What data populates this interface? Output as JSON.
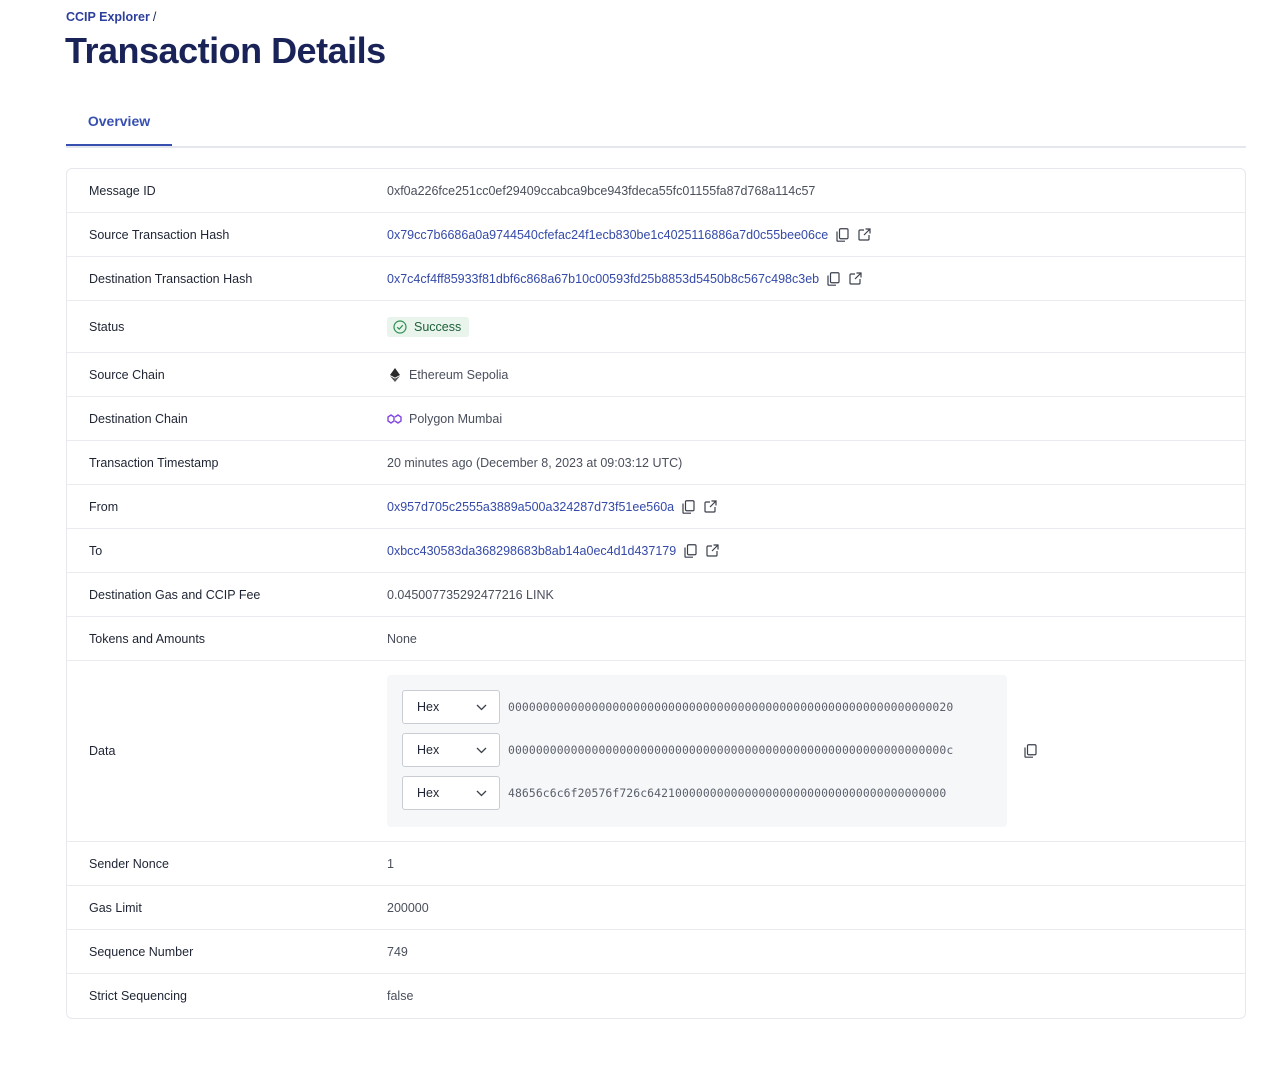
{
  "breadcrumb": {
    "root": "CCIP Explorer",
    "separator": "/"
  },
  "page": {
    "title": "Transaction Details"
  },
  "tabs": [
    {
      "label": "Overview",
      "active": true
    }
  ],
  "details": {
    "message_id": {
      "label": "Message ID",
      "value": "0xf0a226fce251cc0ef29409ccabca9bce943fdeca55fc01155fa87d768a114c57"
    },
    "source_tx_hash": {
      "label": "Source Transaction Hash",
      "value": "0x79cc7b6686a0a9744540cfefac24f1ecb830be1c4025116886a7d0c55bee06ce"
    },
    "dest_tx_hash": {
      "label": "Destination Transaction Hash",
      "value": "0x7c4cf4ff85933f81dbf6c868a67b10c00593fd25b8853d5450b8c567c498c3eb"
    },
    "status": {
      "label": "Status",
      "value": "Success"
    },
    "source_chain": {
      "label": "Source Chain",
      "value": "Ethereum Sepolia",
      "icon": "ethereum-icon"
    },
    "dest_chain": {
      "label": "Destination Chain",
      "value": "Polygon Mumbai",
      "icon": "polygon-icon"
    },
    "timestamp": {
      "label": "Transaction Timestamp",
      "value": "20 minutes ago (December 8, 2023 at 09:03:12 UTC)"
    },
    "from": {
      "label": "From",
      "value": "0x957d705c2555a3889a500a324287d73f51ee560a"
    },
    "to": {
      "label": "To",
      "value": "0xbcc430583da368298683b8ab14a0ec4d1d437179"
    },
    "fee": {
      "label": "Destination Gas and CCIP Fee",
      "value": "0.045007735292477216 LINK"
    },
    "tokens": {
      "label": "Tokens and Amounts",
      "value": "None"
    },
    "data": {
      "label": "Data",
      "lines": [
        {
          "format": "Hex",
          "value": "0000000000000000000000000000000000000000000000000000000000000020"
        },
        {
          "format": "Hex",
          "value": "000000000000000000000000000000000000000000000000000000000000000c"
        },
        {
          "format": "Hex",
          "value": "48656c6c6f20576f726c6421000000000000000000000000000000000000000"
        }
      ]
    },
    "sender_nonce": {
      "label": "Sender Nonce",
      "value": "1"
    },
    "gas_limit": {
      "label": "Gas Limit",
      "value": "200000"
    },
    "sequence_number": {
      "label": "Sequence Number",
      "value": "749"
    },
    "strict_sequencing": {
      "label": "Strict Sequencing",
      "value": "false"
    }
  },
  "colors": {
    "title": "#1a2357",
    "link": "#3449a8",
    "tab_active": "#3750b0",
    "success_bg": "#e8f4ec",
    "success_fg": "#1f5f37"
  }
}
